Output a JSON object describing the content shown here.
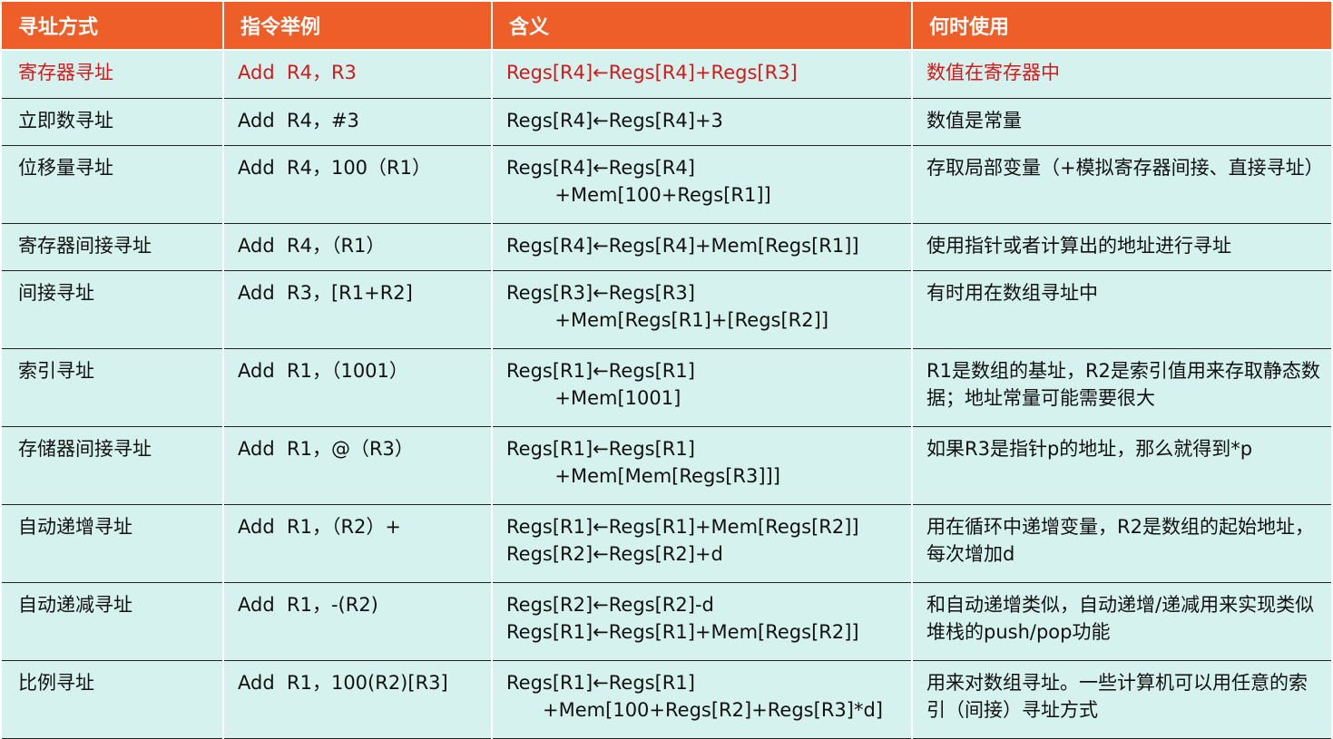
{
  "headers": [
    "寻址方式",
    "指令举例",
    "含义",
    "何时使用"
  ],
  "rows": [
    {
      "mode": "寄存器寻址",
      "example": "Add  R4，R3",
      "meaning": [
        "Regs[R4]←Regs[R4]+Regs[R3]"
      ],
      "usage": "数值在寄存器中",
      "highlight": true
    },
    {
      "mode": "立即数寻址",
      "example": "Add  R4，#3",
      "meaning": [
        "Regs[R4]←Regs[R4]+3"
      ],
      "usage": "数值是常量"
    },
    {
      "mode": "位移量寻址",
      "example": "Add  R4，100（R1）",
      "meaning": [
        "Regs[R4]←Regs[R4]",
        "        +Mem[100+Regs[R1]]"
      ],
      "usage": "存取局部变量（+模拟寄存器间接、直接寻址）"
    },
    {
      "mode": "寄存器间接寻址",
      "example": "Add  R4，（R1）",
      "meaning": [
        "Regs[R4]←Regs[R4]+Mem[Regs[R1]]"
      ],
      "usage": "使用指针或者计算出的地址进行寻址"
    },
    {
      "mode": "间接寻址",
      "example": "Add  R3，[R1+R2]",
      "meaning": [
        "Regs[R3]←Regs[R3]",
        "        +Mem[Regs[R1]+[Regs[R2]]"
      ],
      "usage": "有时用在数组寻址中"
    },
    {
      "mode": "索引寻址",
      "example": "Add  R1，（1001）",
      "meaning": [
        "Regs[R1]←Regs[R1]",
        "        +Mem[1001]"
      ],
      "usage": "R1是数组的基址，R2是索引值用来存取静态数据；地址常量可能需要很大"
    },
    {
      "mode": "存储器间接寻址",
      "example": "Add  R1，@（R3）",
      "meaning": [
        "Regs[R1]←Regs[R1]",
        "        +Mem[Mem[Regs[R3]]]"
      ],
      "usage": "如果R3是指针p的地址，那么就得到*p"
    },
    {
      "mode": "自动递增寻址",
      "example": "Add  R1，（R2）+",
      "meaning": [
        "Regs[R1]←Regs[R1]+Mem[Regs[R2]]",
        "Regs[R2]←Regs[R2]+d"
      ],
      "usage": "用在循环中递增变量，R2是数组的起始地址，每次增加d"
    },
    {
      "mode": "自动递减寻址",
      "example": "Add  R1，-(R2)",
      "meaning": [
        "Regs[R2]←Regs[R2]-d",
        "Regs[R1]←Regs[R1]+Mem[Regs[R2]]"
      ],
      "usage": "和自动递增类似，自动递增/递减用来实现类似堆栈的push/pop功能"
    },
    {
      "mode": "比例寻址",
      "example": "Add  R1，100(R2)[R3]",
      "meaning": [
        "Regs[R1]←Regs[R1]",
        "      +Mem[100+Regs[R2]+Regs[R3]*d]"
      ],
      "usage": "用来对数组寻址。一些计算机可以用任意的索引（间接）寻址方式"
    }
  ],
  "colors": {
    "header_bg": "#ed5e29",
    "row_bg": "#d6f2ee",
    "highlight_text": "#d11a1a"
  }
}
